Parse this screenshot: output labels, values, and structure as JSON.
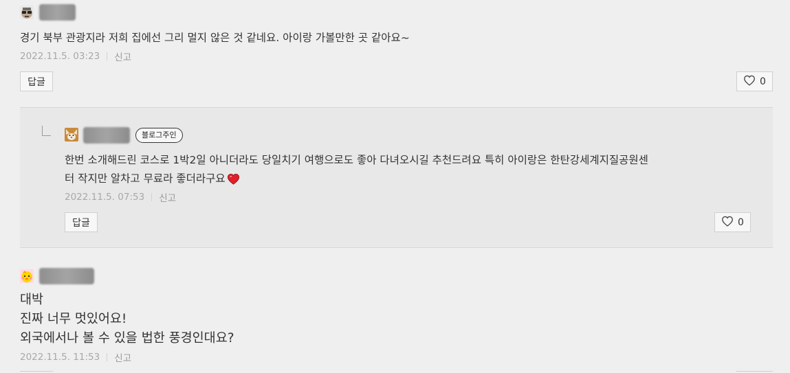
{
  "comments": [
    {
      "text": "경기 북부 관광지라 저희 집에선 그리 멀지 않은 것 같네요. 아이랑 가볼만한 곳 같아요~",
      "date": "2022.11.5. 03:23",
      "report": "신고",
      "reply_label": "답글",
      "likes": "0"
    },
    {
      "badge": "블로그주인",
      "text_line1": "한번 소개해드린 코스로 1박2일 아니더라도 당일치기 여행으로도 좋아 다녀오시길 추천드려요 특히 아이랑은 한탄강세계지질공원센",
      "text_line2": "터 작지만 알차고 무료라 좋더라구요",
      "date": "2022.11.5. 07:53",
      "report": "신고",
      "reply_label": "답글",
      "likes": "0"
    },
    {
      "line1": "대박",
      "line2": "진짜 너무 멋있어요!",
      "line3": "외국에서나 볼 수 있을 법한 풍경인대요?",
      "date": "2022.11.5. 11:53",
      "report": "신고"
    }
  ],
  "colors": {
    "heart_emoji": "#e0202a",
    "background": "#efefef",
    "reply_background": "#e8e8e8"
  }
}
